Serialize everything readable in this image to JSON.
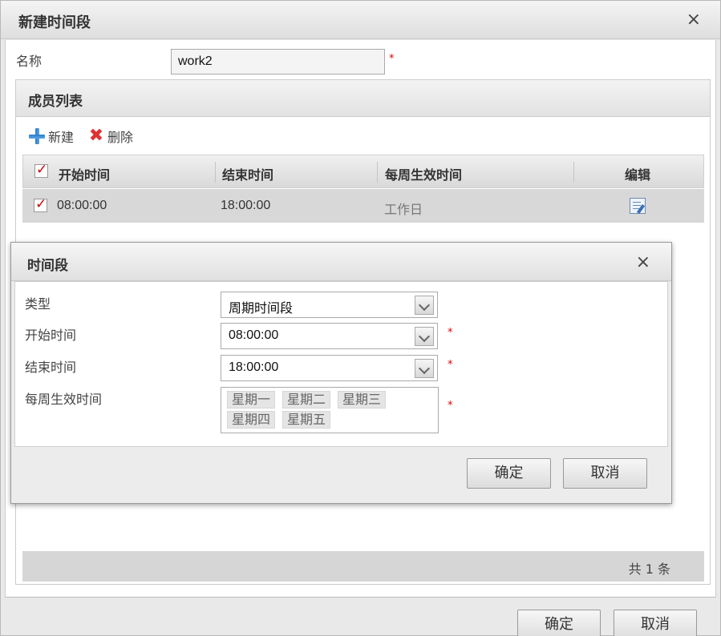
{
  "dialog": {
    "title": "新建时间段",
    "close_glyph": "×",
    "name_label": "名称",
    "name_value": "work2",
    "required_mark": "*",
    "ok_label": "确定",
    "cancel_label": "取消"
  },
  "members": {
    "title": "成员列表",
    "toolbar": {
      "add_label": "新建",
      "delete_label": "删除"
    },
    "columns": [
      "开始时间",
      "结束时间",
      "每周生效时间",
      "编辑"
    ],
    "rows": [
      {
        "start": "08:00:00",
        "end": "18:00:00",
        "weekly": "工作日",
        "checked": true
      }
    ],
    "footer": "共 1 条"
  },
  "period_dialog": {
    "title": "时间段",
    "close_glyph": "×",
    "type_label": "类型",
    "type_value": "周期时间段",
    "start_label": "开始时间",
    "start_value": "08:00:00",
    "end_label": "结束时间",
    "end_value": "18:00:00",
    "weekly_label": "每周生效时间",
    "weekdays": [
      "星期一",
      "星期二",
      "星期三",
      "星期四",
      "星期五"
    ],
    "ok_label": "确定",
    "cancel_label": "取消"
  },
  "icons": {
    "add": "plus-icon",
    "delete": "delete-x-icon",
    "edit": "edit-icon",
    "close": "close-icon",
    "dropdown": "chevron-down-icon",
    "checkbox": "checkbox-checked-icon"
  },
  "colors": {
    "required": "#dd0000",
    "check": "#cc0000",
    "add_icon": "#2b7bc7",
    "delete_icon": "#dd3333"
  }
}
